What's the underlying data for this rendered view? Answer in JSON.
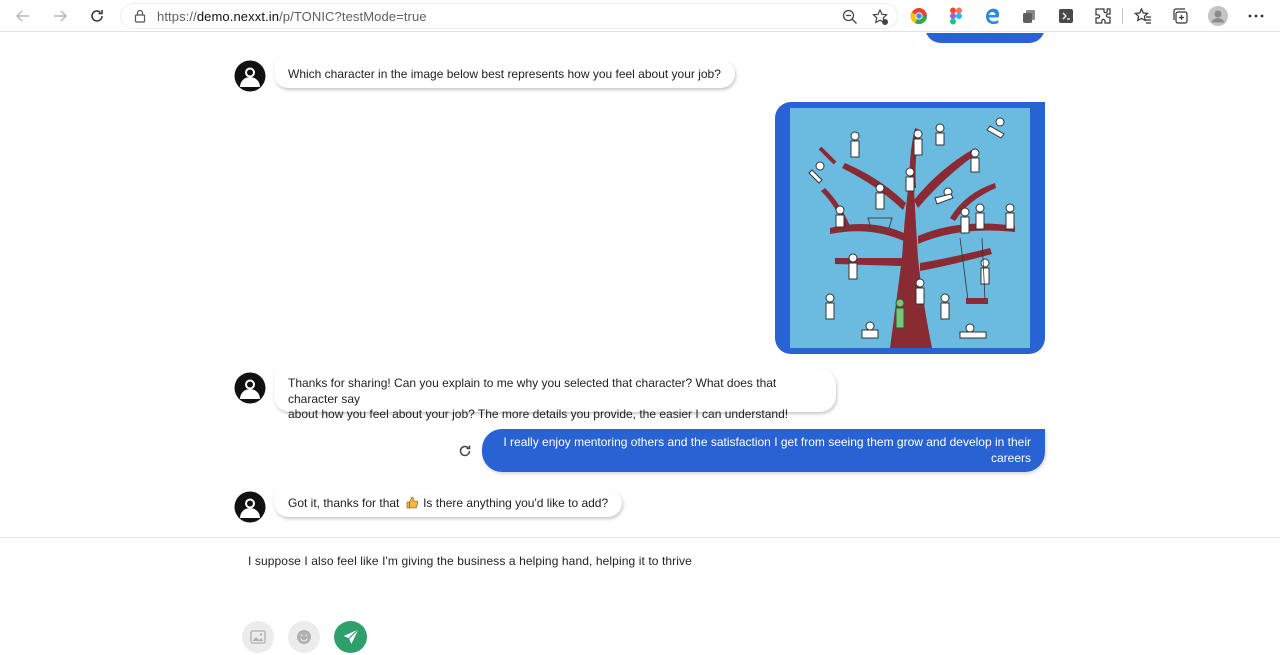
{
  "browser": {
    "url_prefix": "https://",
    "url_host": "demo.nexxt.in",
    "url_path": "/p/TONIC?testMode=true"
  },
  "chat": {
    "messages": [
      {
        "from": "bot",
        "text": "Which character in the image below best represents how you feel about your job?"
      },
      {
        "from": "user",
        "type": "image",
        "icon": "tree-characters-image"
      },
      {
        "from": "bot",
        "line1": "Thanks for sharing! Can you explain to me why you selected that character? What does that character say",
        "line2": "about how you feel about your job? The more details you provide, the easier I can understand!"
      },
      {
        "from": "user",
        "line1": "I really enjoy mentoring others and the satisfaction I get from seeing them grow and develop in their",
        "line2": "careers"
      },
      {
        "from": "bot",
        "text_before": "Got it, thanks for that",
        "emoji": "thumbs-up-icon",
        "text_after": " Is there anything you'd like to add?"
      }
    ]
  },
  "composer": {
    "input_value": "I suppose I also feel like I'm giving the business a helping hand, helping it to thrive"
  },
  "colors": {
    "user_bubble": "#2962d2",
    "send_button": "#2f9f6c",
    "image_bg": "#6bbbe0"
  }
}
